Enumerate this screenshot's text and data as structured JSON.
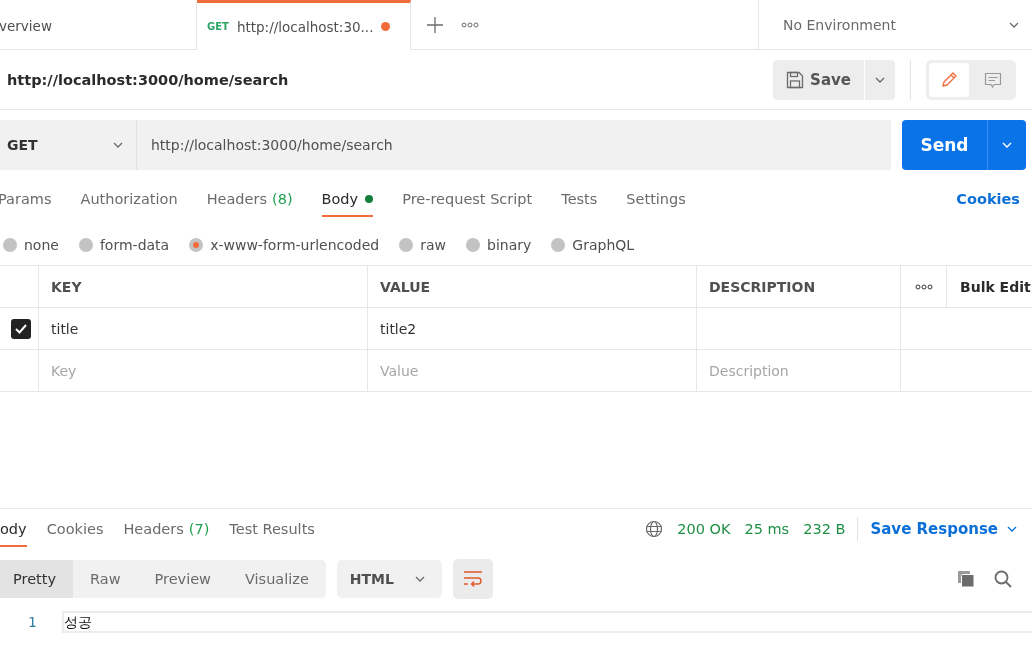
{
  "tabs": [
    {
      "kind": "plain",
      "label": "verview",
      "selected": false,
      "modified": false
    },
    {
      "kind": "request",
      "method": "GET",
      "label": "http://localhost:30...",
      "selected": true,
      "modified": true
    }
  ],
  "environment": {
    "label": "No Environment"
  },
  "request": {
    "title": "http://localhost:3000/home/search",
    "save_label": "Save",
    "modes": [
      {
        "kind": "edit",
        "selected": true
      },
      {
        "kind": "comment",
        "selected": false
      }
    ],
    "method": "GET",
    "url": "http://localhost:3000/home/search",
    "send_label": "Send",
    "tabs": [
      {
        "label": "Params",
        "selected": false
      },
      {
        "label": "Authorization",
        "selected": false
      },
      {
        "label": "Headers",
        "count": "(8)",
        "selected": false
      },
      {
        "label": "Body",
        "selected": true,
        "has_content": true
      },
      {
        "label": "Pre-request Script",
        "selected": false
      },
      {
        "label": "Tests",
        "selected": false
      },
      {
        "label": "Settings",
        "selected": false
      }
    ],
    "cookies_label": "Cookies",
    "body_types": [
      {
        "label": "none",
        "selected": false
      },
      {
        "label": "form-data",
        "selected": false
      },
      {
        "label": "x-www-form-urlencoded",
        "selected": true
      },
      {
        "label": "raw",
        "selected": false
      },
      {
        "label": "binary",
        "selected": false
      },
      {
        "label": "GraphQL",
        "selected": false
      }
    ],
    "table": {
      "columns": [
        "KEY",
        "VALUE",
        "DESCRIPTION"
      ],
      "bulk_edit": "Bulk Edit",
      "rows": [
        {
          "checked": true,
          "key": "title",
          "value": "title2"
        }
      ],
      "new_row": {
        "key_placeholder": "Key",
        "value_placeholder": "Value",
        "description_placeholder": "Description"
      }
    }
  },
  "response": {
    "tabs": [
      {
        "label": "ody",
        "selected": true
      },
      {
        "label": "Cookies",
        "selected": false
      },
      {
        "label": "Headers",
        "count": "(7)",
        "selected": false
      },
      {
        "label": "Test Results",
        "selected": false
      }
    ],
    "status": "200 OK",
    "time": "25 ms",
    "size": "232 B",
    "save_label": "Save Response",
    "views": [
      {
        "label": "Pretty",
        "selected": true
      },
      {
        "label": "Raw",
        "selected": false
      },
      {
        "label": "Preview",
        "selected": false
      },
      {
        "label": "Visualize",
        "selected": false
      }
    ],
    "format": "HTML",
    "line_wrap": true,
    "lines": [
      {
        "number": "1",
        "text": "성공"
      }
    ]
  }
}
